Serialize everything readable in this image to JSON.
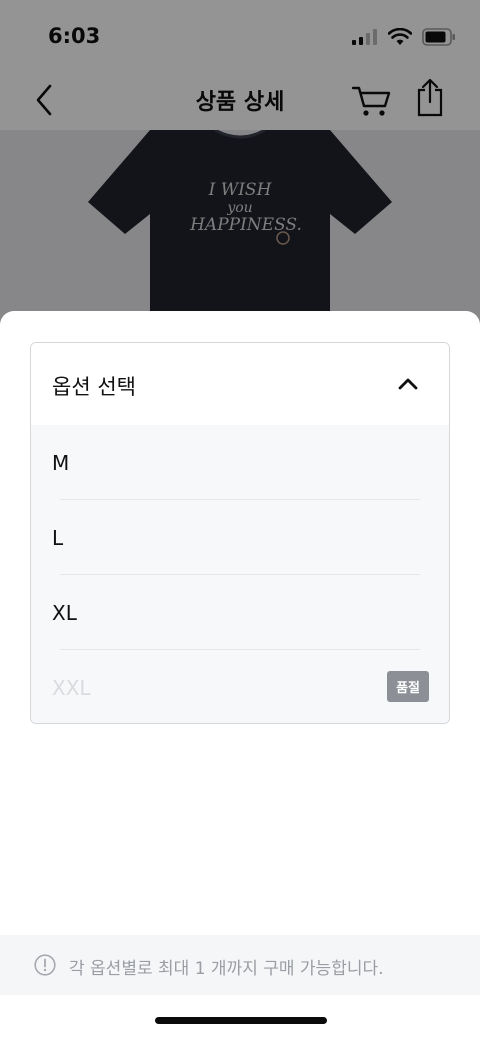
{
  "status_bar": {
    "time": "6:03"
  },
  "nav": {
    "title": "상품 상세"
  },
  "product": {
    "print_line1": "I WISH",
    "print_line2": "you",
    "print_line3": "HAPPINESS."
  },
  "option_panel": {
    "header": "옵션 선택",
    "options": [
      {
        "label": "M",
        "sold_out": false
      },
      {
        "label": "L",
        "sold_out": false
      },
      {
        "label": "XL",
        "sold_out": false
      },
      {
        "label": "XXL",
        "sold_out": true,
        "badge": "품절"
      }
    ]
  },
  "notice": {
    "text": "각 옵션별로 최대 1 개까지 구매 가능합니다."
  },
  "colors": {
    "dim_overlay": "#000000",
    "soldout_badge": "#8c9096",
    "notice_text": "#9a9da3"
  }
}
